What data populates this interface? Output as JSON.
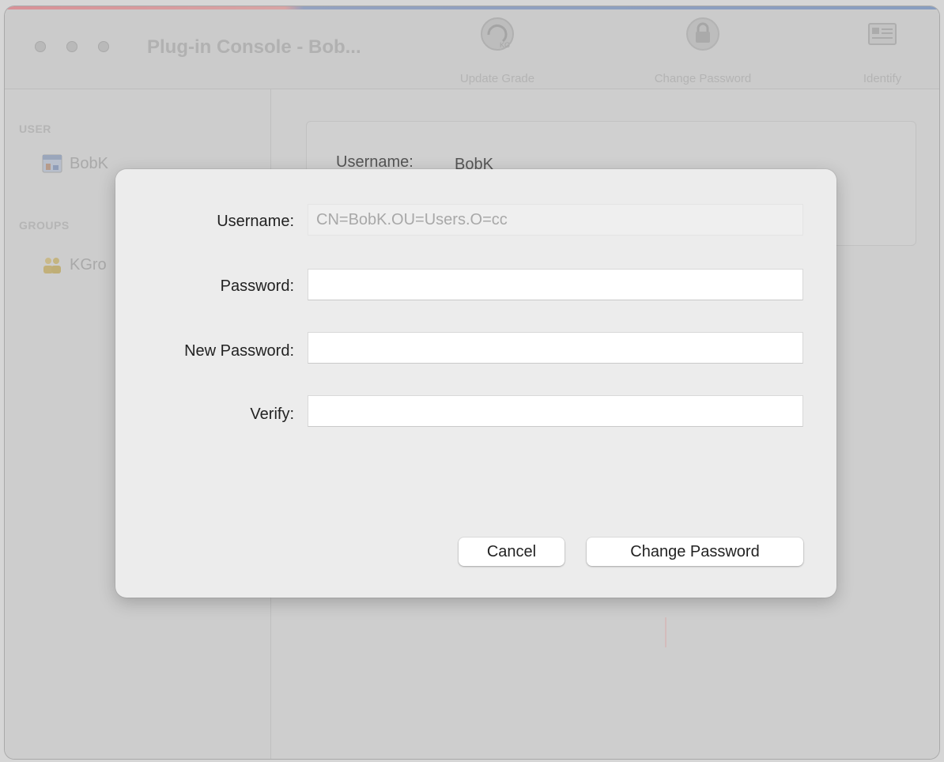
{
  "window": {
    "title": "Plug-in Console - Bob..."
  },
  "toolbar": {
    "buttons": [
      {
        "label": "Update Grade",
        "icon": "update-icon"
      },
      {
        "label": "Change Password",
        "icon": "lock-icon"
      },
      {
        "label": "Identify",
        "icon": "id-card-icon"
      }
    ]
  },
  "sidebar": {
    "user_section": "USER",
    "user_item": "BobK",
    "groups_section": "GROUPS",
    "group_item": "KGro"
  },
  "main": {
    "username_label": "Username:",
    "username_value": "BobK"
  },
  "dialog": {
    "username_label": "Username:",
    "username_value": "CN=BobK.OU=Users.O=cc",
    "password_label": "Password:",
    "password_value": "",
    "new_password_label": "New Password:",
    "new_password_value": "",
    "verify_label": "Verify:",
    "verify_value": "",
    "cancel_label": "Cancel",
    "submit_label": "Change Password"
  }
}
